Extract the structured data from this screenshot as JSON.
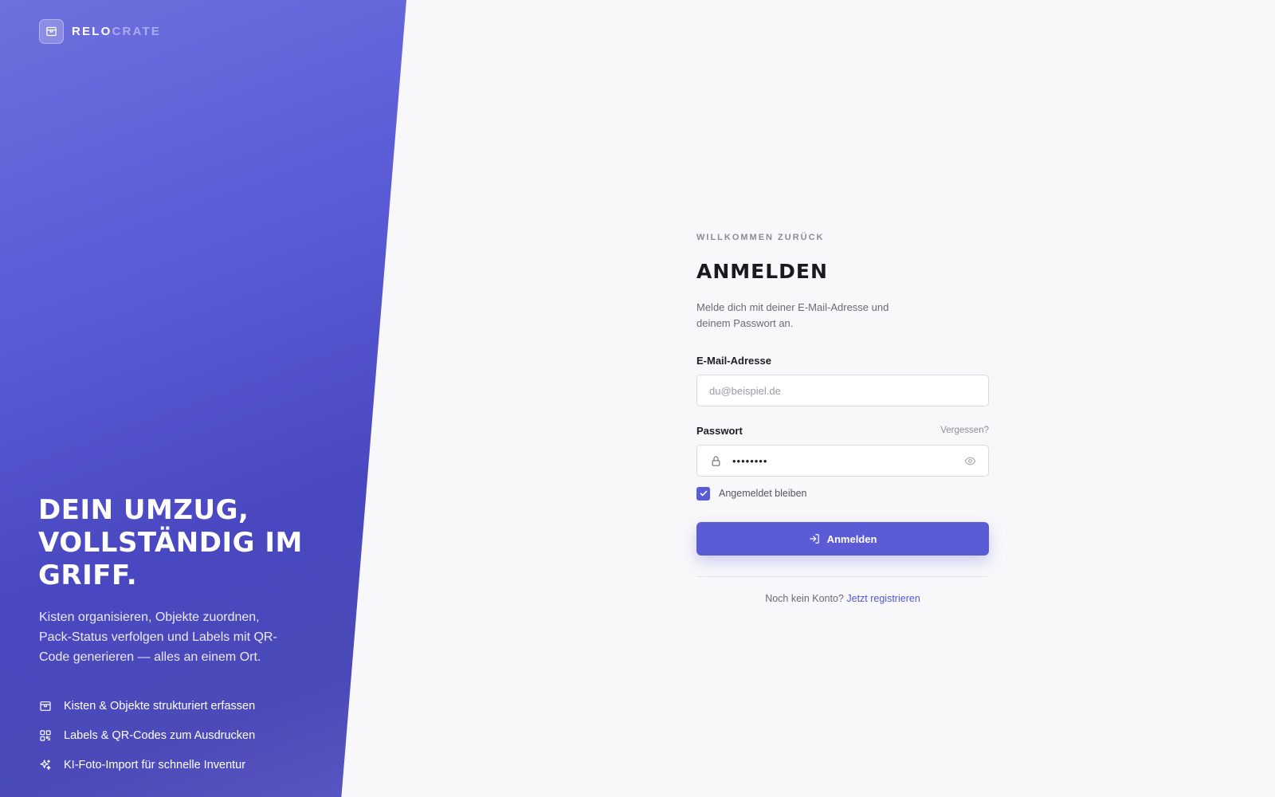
{
  "brand": {
    "name_part1": "RELO",
    "name_part2": "CRATE",
    "logo_icon": "box-icon"
  },
  "hero": {
    "title": "Dein Umzug, vollständig im Griff.",
    "description": "Kisten organisieren, Objekte zuordnen, Pack-Status verfolgen und Labels mit QR-Code generieren — alles an einem Ort.",
    "features": [
      {
        "icon": "box-icon",
        "label": "Kisten & Objekte strukturiert erfassen"
      },
      {
        "icon": "qr-code-icon",
        "label": "Labels & QR-Codes zum Ausdrucken"
      },
      {
        "icon": "sparkles-icon",
        "label": "KI-Foto-Import für schnelle Inventur"
      }
    ]
  },
  "login": {
    "eyebrow": "WILLKOMMEN ZURÜCK",
    "title": "ANMELDEN",
    "subtitle": "Melde dich mit deiner E-Mail-Adresse und deinem Passwort an.",
    "email": {
      "label": "E-Mail-Adresse",
      "placeholder": "du@beispiel.de",
      "value": ""
    },
    "password": {
      "label": "Passwort",
      "forgot_label": "Vergessen?",
      "value": "••••••••"
    },
    "remember": {
      "label": "Angemeldet bleiben",
      "checked": true
    },
    "submit_label": "Anmelden",
    "register_prompt": "Noch kein Konto?",
    "register_link": "Jetzt registrieren"
  },
  "colors": {
    "accent": "#5b5bd6",
    "link": "#5256d6",
    "background": "#f8f8fa"
  }
}
